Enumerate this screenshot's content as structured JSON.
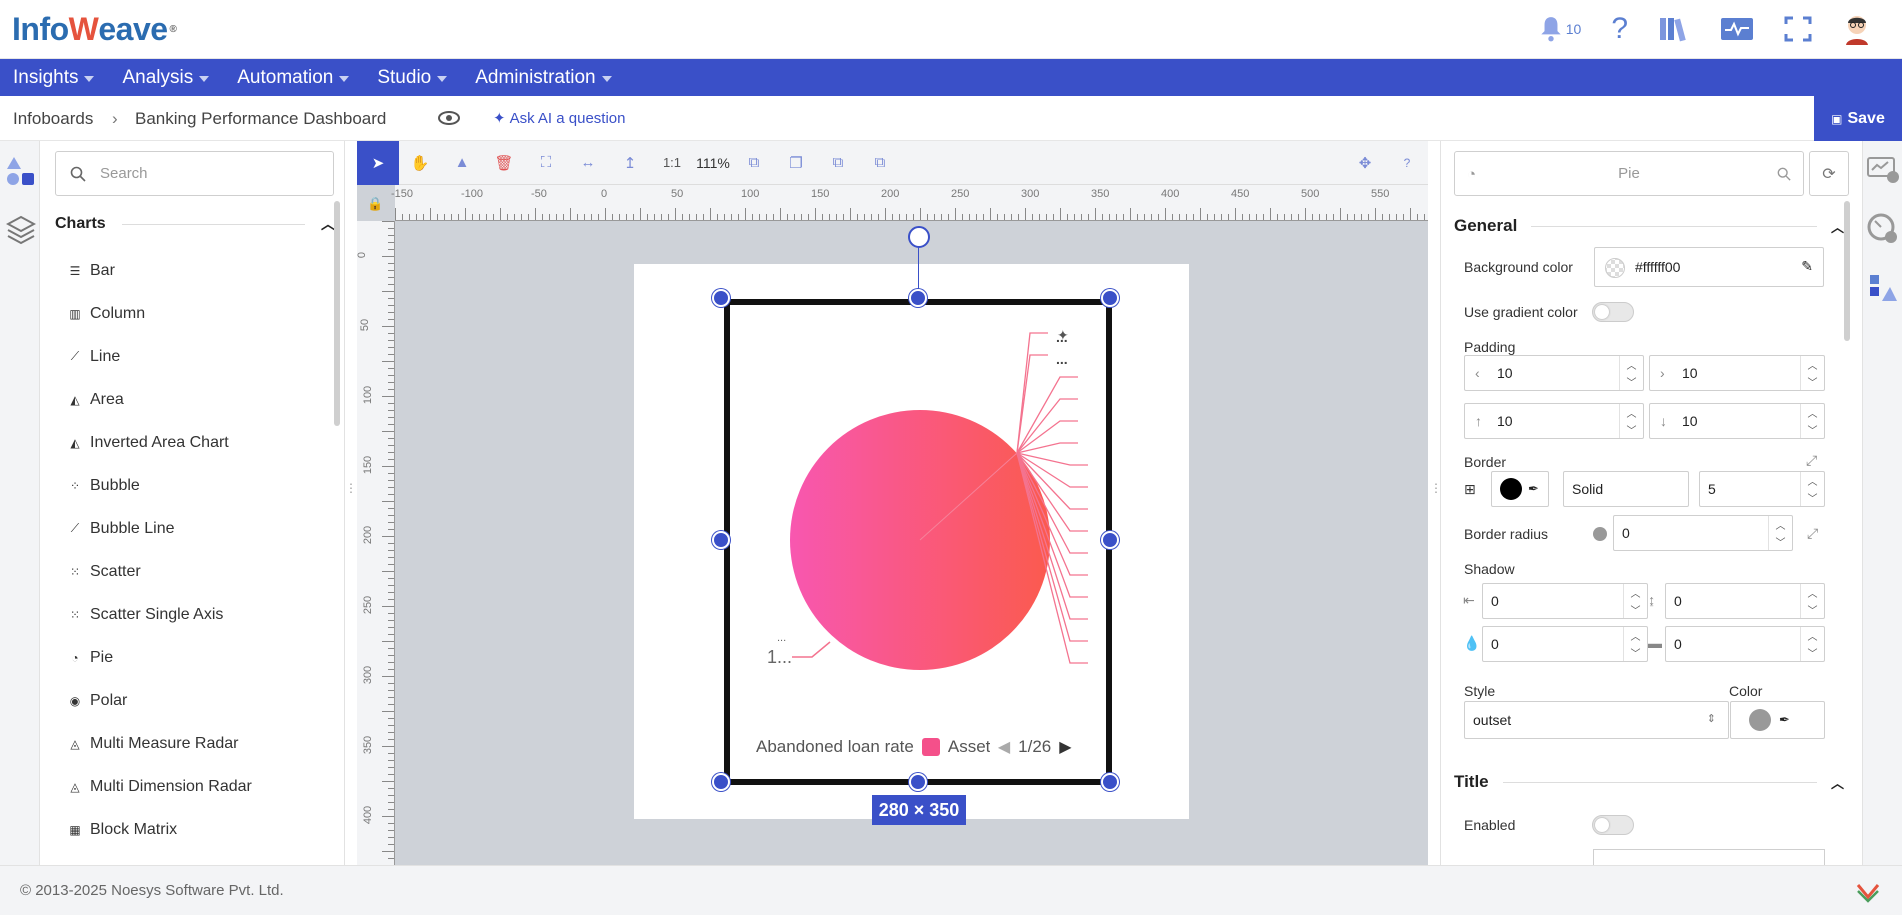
{
  "app": {
    "logo_text": "Infoweave",
    "notification_count": "10",
    "top_icons": [
      "bell-icon",
      "help-icon",
      "library-icon",
      "monitor-icon",
      "fullscreen-icon",
      "user-avatar"
    ]
  },
  "menu": {
    "items": [
      {
        "label": "Insights"
      },
      {
        "label": "Analysis"
      },
      {
        "label": "Automation"
      },
      {
        "label": "Studio"
      },
      {
        "label": "Administration"
      }
    ]
  },
  "breadcrumb": {
    "root": "Infoboards",
    "current": "Banking Performance Dashboard",
    "ask_ai": "Ask AI a question",
    "save": "Save"
  },
  "left_panel": {
    "search_placeholder": "Search",
    "section_title": "Charts",
    "charts": [
      {
        "label": "Bar",
        "icon": "bar-chart-icon"
      },
      {
        "label": "Column",
        "icon": "column-chart-icon"
      },
      {
        "label": "Line",
        "icon": "line-chart-icon"
      },
      {
        "label": "Area",
        "icon": "area-chart-icon"
      },
      {
        "label": "Inverted Area Chart",
        "icon": "inverted-area-chart-icon"
      },
      {
        "label": "Bubble",
        "icon": "bubble-chart-icon"
      },
      {
        "label": "Bubble Line",
        "icon": "bubble-line-chart-icon"
      },
      {
        "label": "Scatter",
        "icon": "scatter-chart-icon"
      },
      {
        "label": "Scatter Single Axis",
        "icon": "scatter-single-axis-icon"
      },
      {
        "label": "Pie",
        "icon": "pie-chart-icon"
      },
      {
        "label": "Polar",
        "icon": "polar-chart-icon"
      },
      {
        "label": "Multi Measure Radar",
        "icon": "radar-chart-icon"
      },
      {
        "label": "Multi Dimension Radar",
        "icon": "radar-chart-icon"
      },
      {
        "label": "Block Matrix",
        "icon": "block-matrix-icon"
      }
    ]
  },
  "canvas": {
    "zoom_ratio": "1:1",
    "zoom_percent": "111%",
    "ruler_h": [
      "-150",
      "-100",
      "-50",
      "0",
      "50",
      "100",
      "150",
      "200",
      "250",
      "300",
      "350",
      "400",
      "450",
      "500",
      "550"
    ],
    "ruler_v": [
      "0",
      "50",
      "100",
      "150",
      "200",
      "250",
      "300",
      "350",
      "400"
    ],
    "selection_size": "280 × 350"
  },
  "widget_chart": {
    "legend_label": "Abandoned loan rate",
    "legend_item": "Asset",
    "legend_page": "1/26",
    "left_label": "1...",
    "left_label_small": "...",
    "label_more": "...",
    "colors": {
      "start": "#f857b0",
      "end": "#fb5a4e",
      "leader": "#f4738f"
    }
  },
  "chart_data": {
    "type": "pie",
    "title": "",
    "legend_title": "Abandoned loan rate",
    "categories": [
      "Asset"
    ],
    "legend_pages": "1/26",
    "note": ""
  },
  "right_panel": {
    "search_placeholder": "Pie",
    "general": {
      "title": "General",
      "background_color_label": "Background color",
      "background_color_value": "#ffffff00",
      "gradient_label": "Use gradient color",
      "padding_label": "Padding",
      "padding_left": "10",
      "padding_right": "10",
      "padding_top": "10",
      "padding_bottom": "10",
      "border_label": "Border",
      "border_style": "Solid",
      "border_width": "5",
      "border_radius_label": "Border radius",
      "border_radius_value": "0",
      "shadow_label": "Shadow",
      "shadow_x": "0",
      "shadow_y": "0",
      "shadow_blur": "0",
      "shadow_spread": "0",
      "style_label": "Style",
      "style_value": "outset",
      "color_label": "Color"
    },
    "title_section": {
      "title": "Title",
      "enabled_label": "Enabled"
    }
  },
  "footer": {
    "copyright": "© 2013-2025 Noesys Software Pvt. Ltd."
  }
}
